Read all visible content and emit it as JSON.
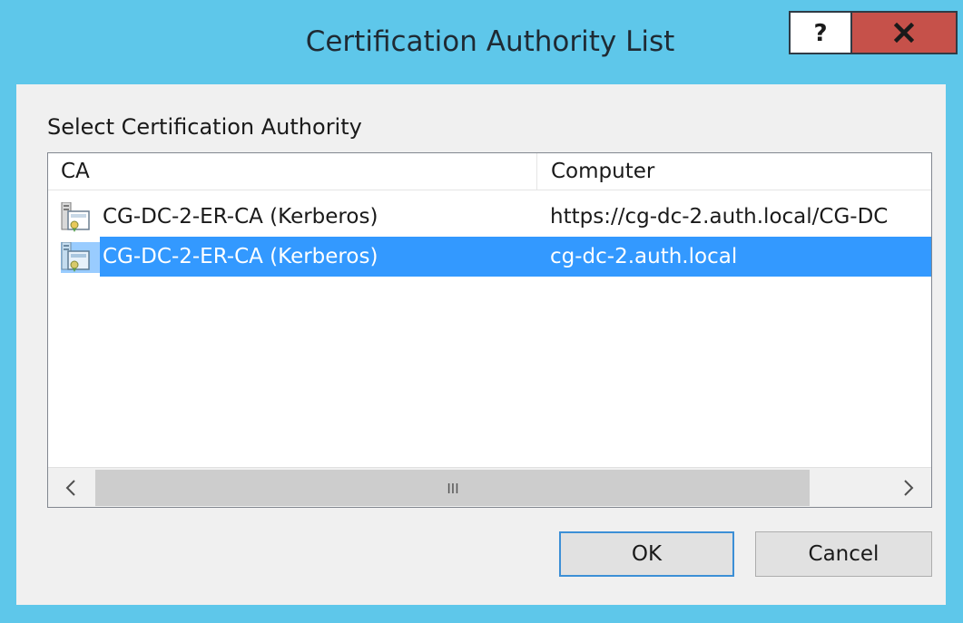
{
  "window": {
    "title": "Certification Authority List",
    "help_label": "?",
    "close_label": "x",
    "titlebar_color": "#5ec7ea",
    "close_color": "#c6514a"
  },
  "dialog": {
    "group_label": "Select Certification Authority",
    "columns": [
      "CA",
      "Computer"
    ],
    "rows": [
      {
        "ca": "CG-DC-2-ER-CA (Kerberos)",
        "computer": "https://cg-dc-2.auth.local/CG-DC",
        "selected": false,
        "icon": "certificate-authority-icon"
      },
      {
        "ca": "CG-DC-2-ER-CA (Kerberos)",
        "computer": "cg-dc-2.auth.local",
        "selected": true,
        "icon": "certificate-authority-icon"
      }
    ],
    "selection_color": "#3399ff",
    "scroll_thumb_label": "III"
  },
  "buttons": {
    "ok_label": "OK",
    "cancel_label": "Cancel"
  }
}
